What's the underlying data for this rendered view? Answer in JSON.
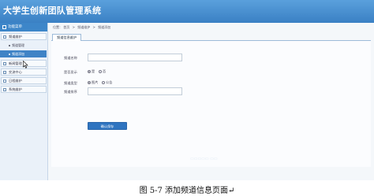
{
  "app": {
    "title": "大学生创新团队管理系统"
  },
  "sidebar": {
    "header": "功能菜单",
    "groups": [
      {
        "label": "频道维护",
        "items": [
          "频道管理",
          "频道添加"
        ]
      },
      {
        "label": "新闻管理"
      },
      {
        "label": "交流中心"
      },
      {
        "label": "日程维护"
      },
      {
        "label": "系统维护"
      }
    ]
  },
  "breadcrumb": {
    "prefix": "位置：",
    "items": [
      "首页",
      "频道维护",
      "频道添加"
    ]
  },
  "tab": {
    "label": "频道信息维护"
  },
  "form": {
    "name_label": "频道名称",
    "show_label": "是否显示",
    "show_options": [
      "是",
      "否"
    ],
    "type_label": "频道类型",
    "type_options": [
      "图片",
      "公告"
    ],
    "order_label": "频道排序",
    "submit_label": "确认保存"
  },
  "caption": "图 5-7 添加频道信息页面↵"
}
